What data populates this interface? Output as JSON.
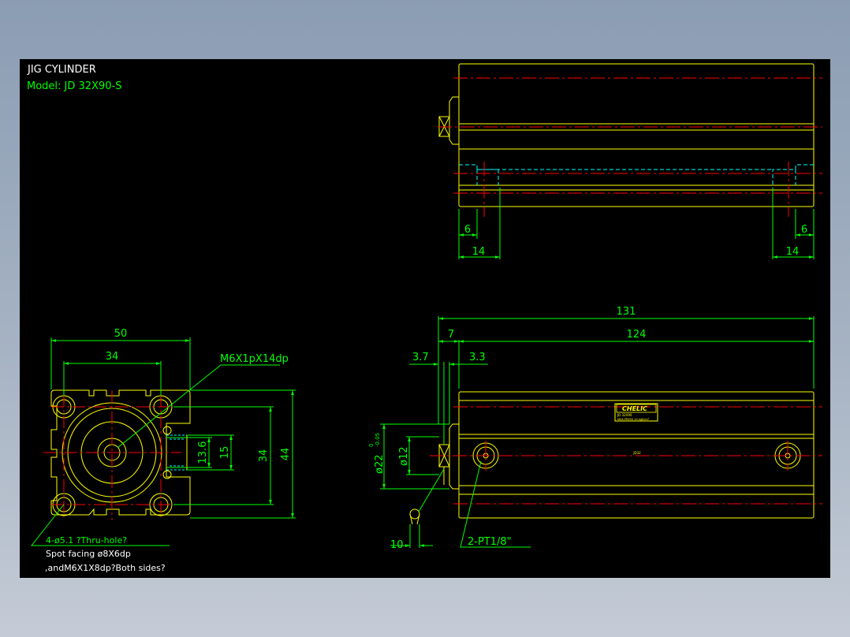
{
  "title": "JIG CYLINDER",
  "model": "Model: JD 32X90-S",
  "colors": {
    "background": "#000000",
    "outline": "#ffff00",
    "dimension": "#00ff00",
    "centerline": "#ff0000",
    "hidden": "#00ffff",
    "title_text": "#ffffff",
    "model_text": "#00ff00"
  },
  "dimensions": {
    "top_left_6": "6",
    "top_right_6": "6",
    "top_left_14": "14",
    "top_right_14": "14",
    "overall_length": "131",
    "body_length": "124",
    "rod_offset": "7",
    "dim_3_7": "3.7",
    "dim_3_3": "3.3",
    "rod_dia": "ø12",
    "boss_dia": "ø22",
    "boss_tol_upper": "0",
    "boss_tol_lower": "-0.05",
    "thread_10": "10",
    "port": "2-PT1/8\"",
    "width_50": "50",
    "pitch_34_h": "34",
    "height_44": "44",
    "pitch_34_v": "34",
    "slot_15": "15",
    "slot_13_6": "13.6",
    "rod_thread": "M6X1pX14dp"
  },
  "notes": {
    "line1": "4-ø5.1 ?Thru-hole?",
    "line2": "Spot facing ø8X6dp",
    "line3": ",andM6X1X8dp?Both sides?"
  },
  "label": {
    "brand": "CHELIC",
    "sub1": "JD 32X90",
    "sub2": "MAX.PRESS 10 kgf/cm²",
    "center_mark": "JD32"
  }
}
